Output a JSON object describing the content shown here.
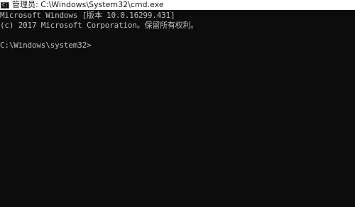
{
  "window": {
    "title": "管理员: C:\\Windows\\System32\\cmd.exe",
    "icon": "cmd-icon",
    "icon_glyph": "C:\\"
  },
  "console": {
    "lines": [
      "Microsoft Windows [版本 10.0.16299.431]",
      "(c) 2017 Microsoft Corporation。保留所有权利。"
    ],
    "prompt": "C:\\Windows\\system32>"
  },
  "colors": {
    "console_bg": "#0c0c0c",
    "console_text": "#c0c0c0",
    "titlebar_bg": "#ffffff"
  }
}
